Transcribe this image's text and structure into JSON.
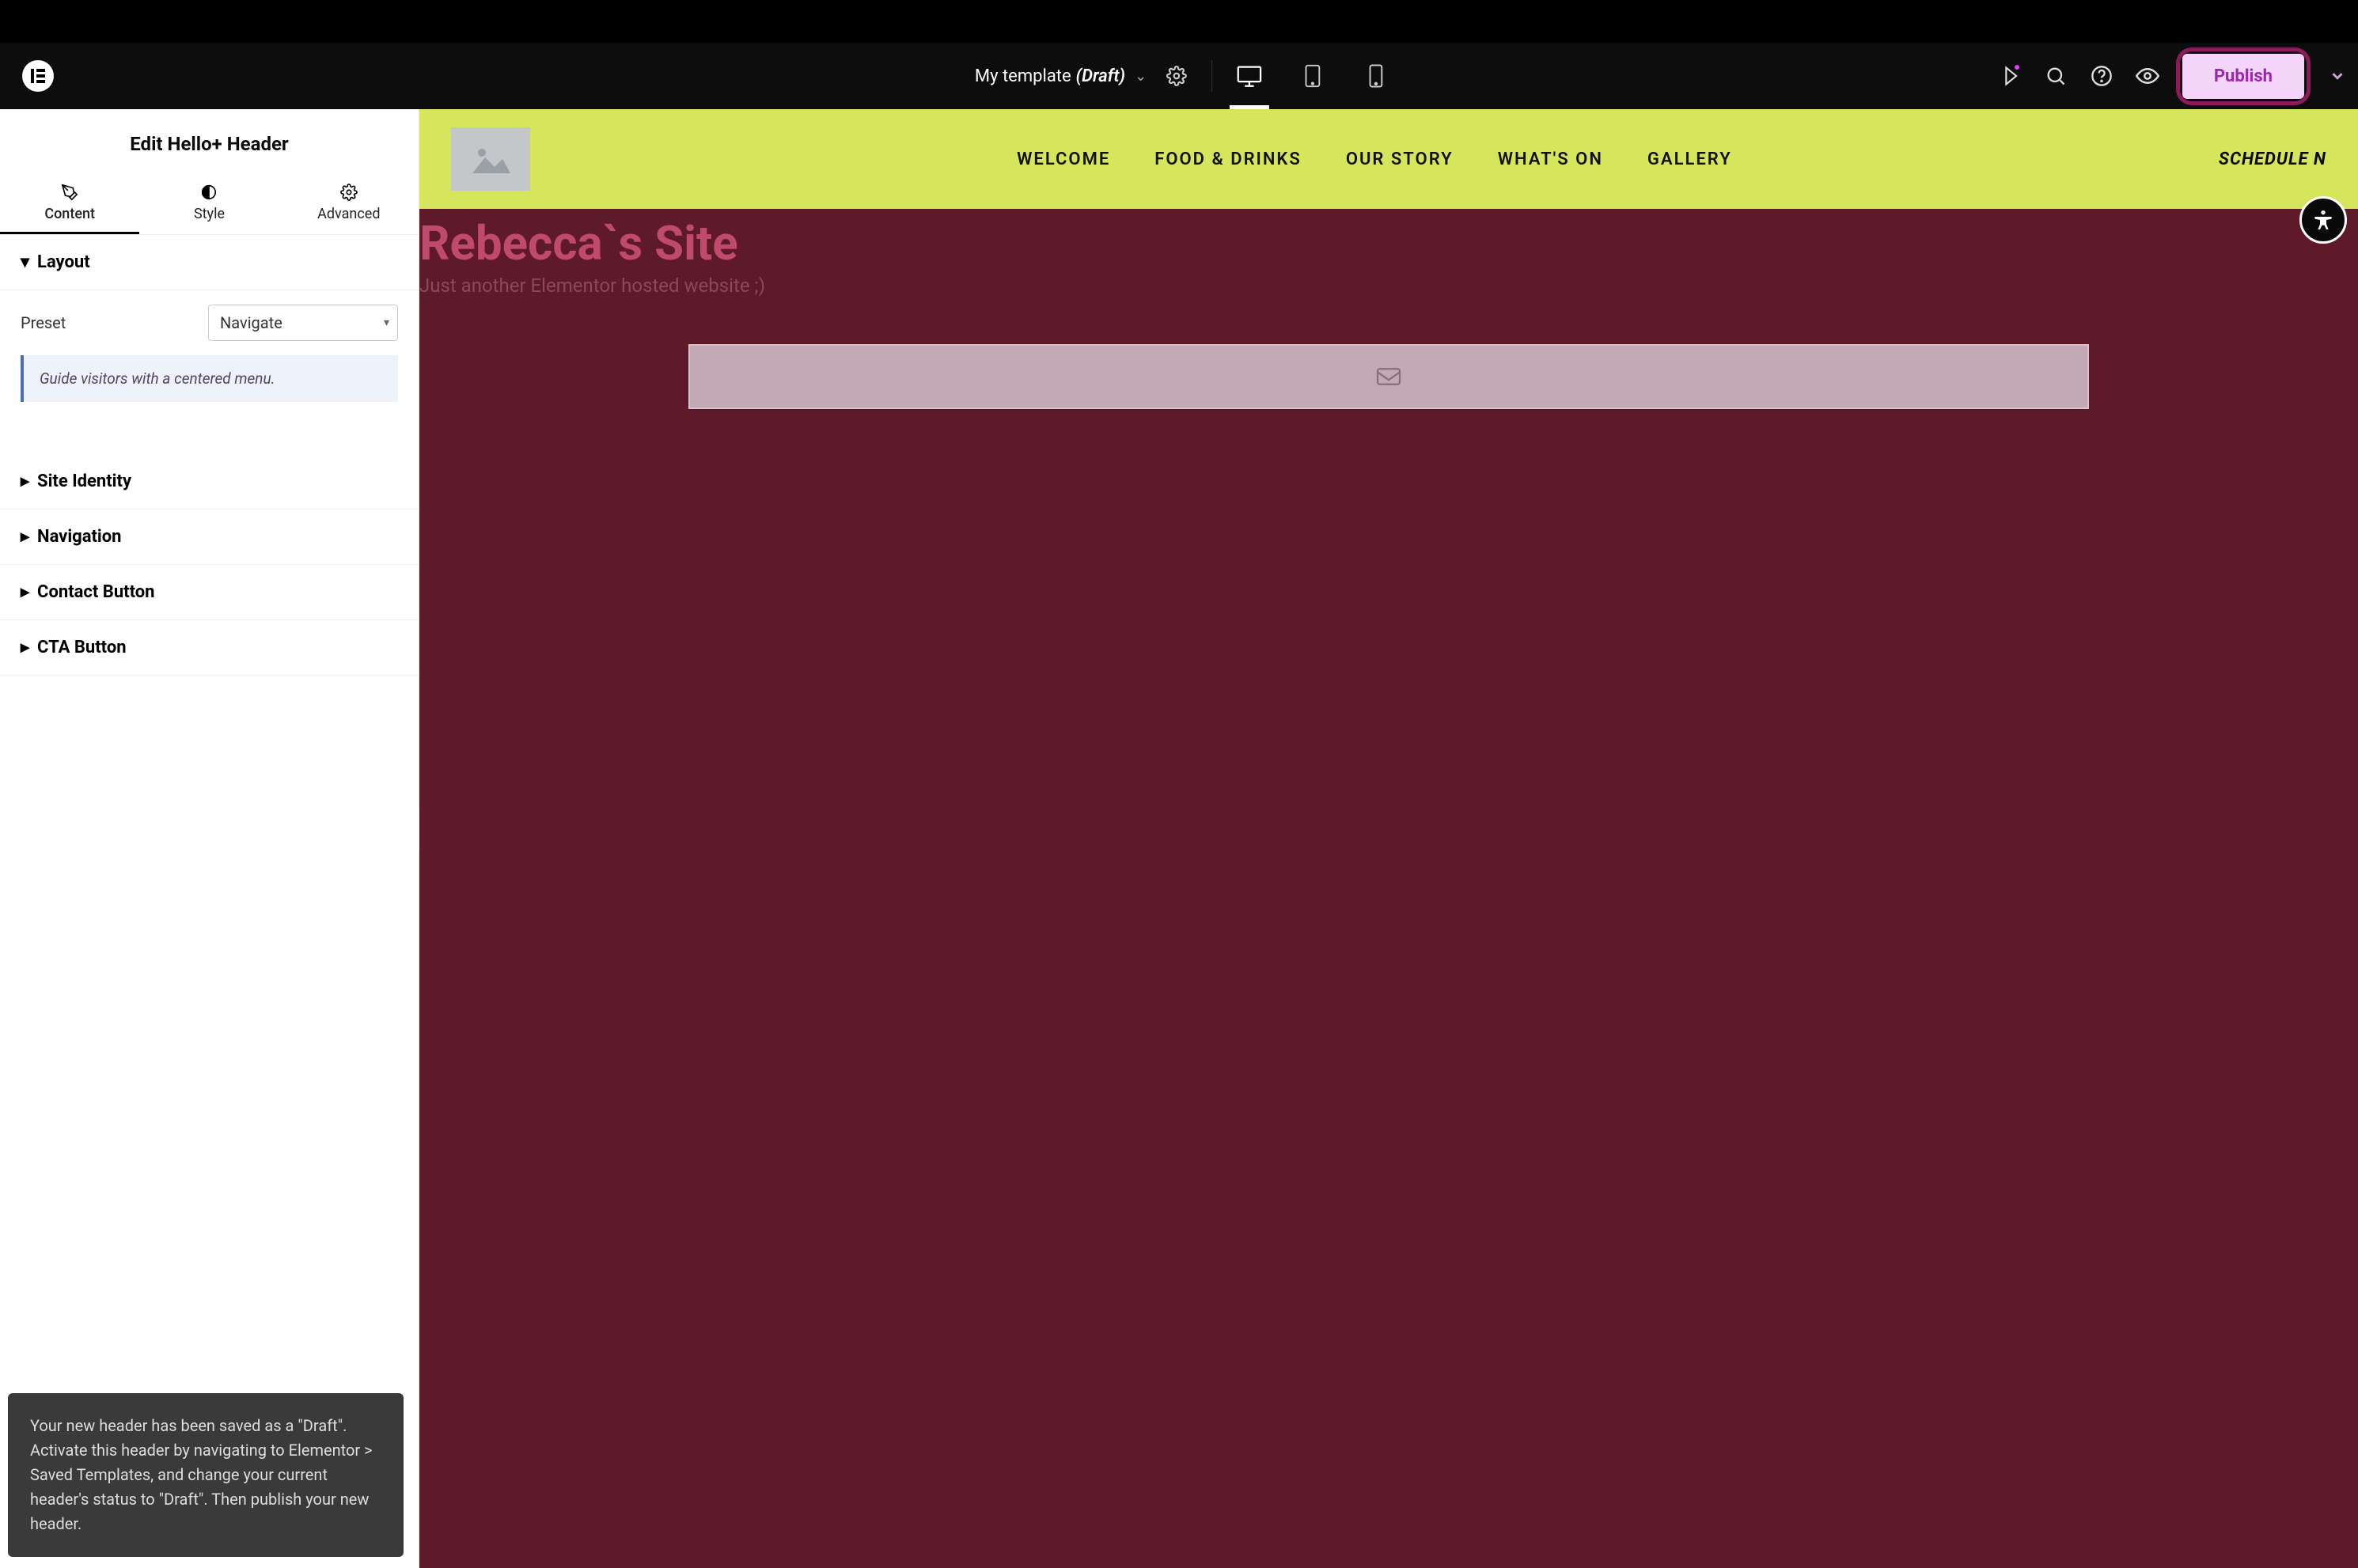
{
  "topbar": {
    "template_name": "My template",
    "draft_label": "(Draft)",
    "publish_label": "Publish"
  },
  "sidebar": {
    "title": "Edit Hello+ Header",
    "tabs": {
      "content": "Content",
      "style": "Style",
      "advanced": "Advanced"
    },
    "sections": {
      "layout": "Layout",
      "site_identity": "Site Identity",
      "navigation": "Navigation",
      "contact_button": "Contact Button",
      "cta_button": "CTA Button"
    },
    "preset_label": "Preset",
    "preset_value": "Navigate",
    "info": "Guide visitors with a centered menu."
  },
  "preview": {
    "nav": [
      "WELCOME",
      "FOOD & DRINKS",
      "OUR STORY",
      "WHAT'S ON",
      "GALLERY"
    ],
    "cta": "SCHEDULE N",
    "hero_title": "Rebecca`s Site",
    "hero_sub": "Just another Elementor hosted website ;)"
  },
  "toast": "Your new header has been saved as a \"Draft\". Activate this header by navigating to Elementor > Saved Templates, and change your current header's status to \"Draft\". Then publish your new header."
}
